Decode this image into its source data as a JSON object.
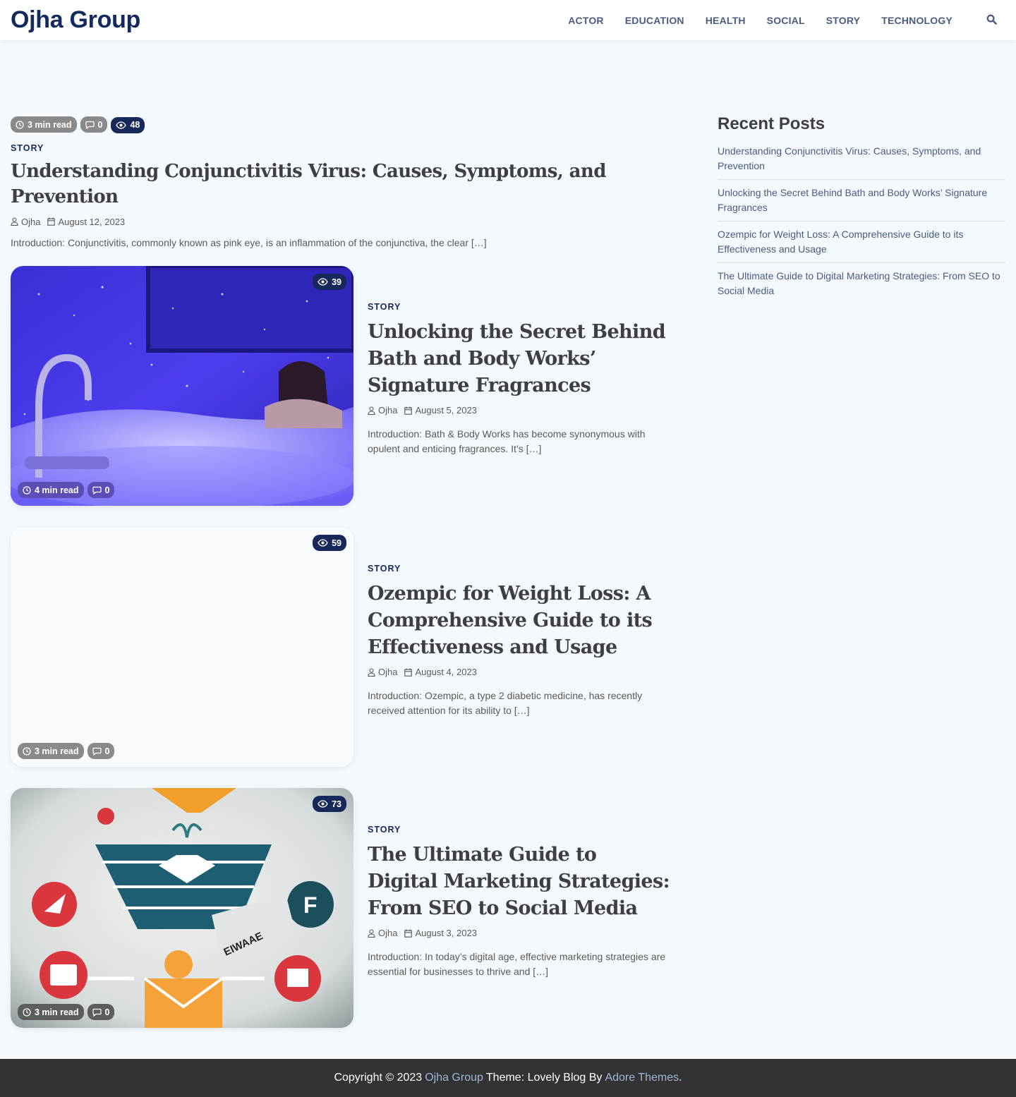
{
  "site": {
    "title": "Ojha Group"
  },
  "nav": {
    "items": [
      {
        "label": "ACTOR"
      },
      {
        "label": "EDUCATION"
      },
      {
        "label": "HEALTH"
      },
      {
        "label": "SOCIAL"
      },
      {
        "label": "STORY"
      },
      {
        "label": "TECHNOLOGY"
      }
    ],
    "search_icon": "search-icon"
  },
  "posts": [
    {
      "read_time": "3 min read",
      "comments": "0",
      "views": "48",
      "category": "STORY",
      "title": "Understanding Conjunctivitis Virus: Causes, Symptoms, and Prevention",
      "author": "Ojha",
      "date": "August 12, 2023",
      "excerpt": "Introduction: Conjunctivitis, commonly known as pink eye, is an inflammation of the conjunctiva, the clear […]"
    },
    {
      "read_time": "4 min read",
      "comments": "0",
      "views": "39",
      "category": "STORY",
      "title": "Unlocking the Secret Behind Bath and Body Works’ Signature Fragrances",
      "author": "Ojha",
      "date": "August 5, 2023",
      "excerpt": " Introduction: Bath & Body Works has become synonymous with opulent and enticing fragrances. It’s […]"
    },
    {
      "read_time": "3 min read",
      "comments": "0",
      "views": "59",
      "category": "STORY",
      "title": "Ozempic for Weight Loss: A Comprehensive Guide to its Effectiveness and Usage",
      "author": "Ojha",
      "date": "August 4, 2023",
      "excerpt": "Introduction: Ozempic, a type 2 diabetic medicine, has recently received attention for its ability to […]"
    },
    {
      "read_time": "3 min read",
      "comments": "0",
      "views": "73",
      "category": "STORY",
      "title": "The Ultimate Guide to Digital Marketing Strategies: From SEO to Social Media",
      "author": "Ojha",
      "date": "August 3, 2023",
      "excerpt": "Introduction: In today’s digital age, effective marketing strategies are essential for businesses to thrive and […]",
      "image_text": "EIWAAE"
    }
  ],
  "sidebar": {
    "title": "Recent Posts",
    "items": [
      "Understanding Conjunctivitis Virus: Causes, Symptoms, and Prevention",
      "Unlocking the Secret Behind Bath and Body Works’ Signature Fragrances",
      "Ozempic for Weight Loss: A Comprehensive Guide to its Effectiveness and Usage",
      "The Ultimate Guide to Digital Marketing Strategies: From SEO to Social Media"
    ]
  },
  "footer": {
    "copyright": "Copyright © 2023",
    "site_link": "Ojha Group",
    "theme_text": "Theme: Lovely Blog By",
    "author_link": "Adore Themes",
    "period": "."
  },
  "colors": {
    "brand": "#132a5e",
    "nav": "#4a5c80",
    "badge_grey": "#8a8a8a",
    "badge_dark": "#17295b",
    "background": "#f3f9fd",
    "footer": "#333333"
  }
}
